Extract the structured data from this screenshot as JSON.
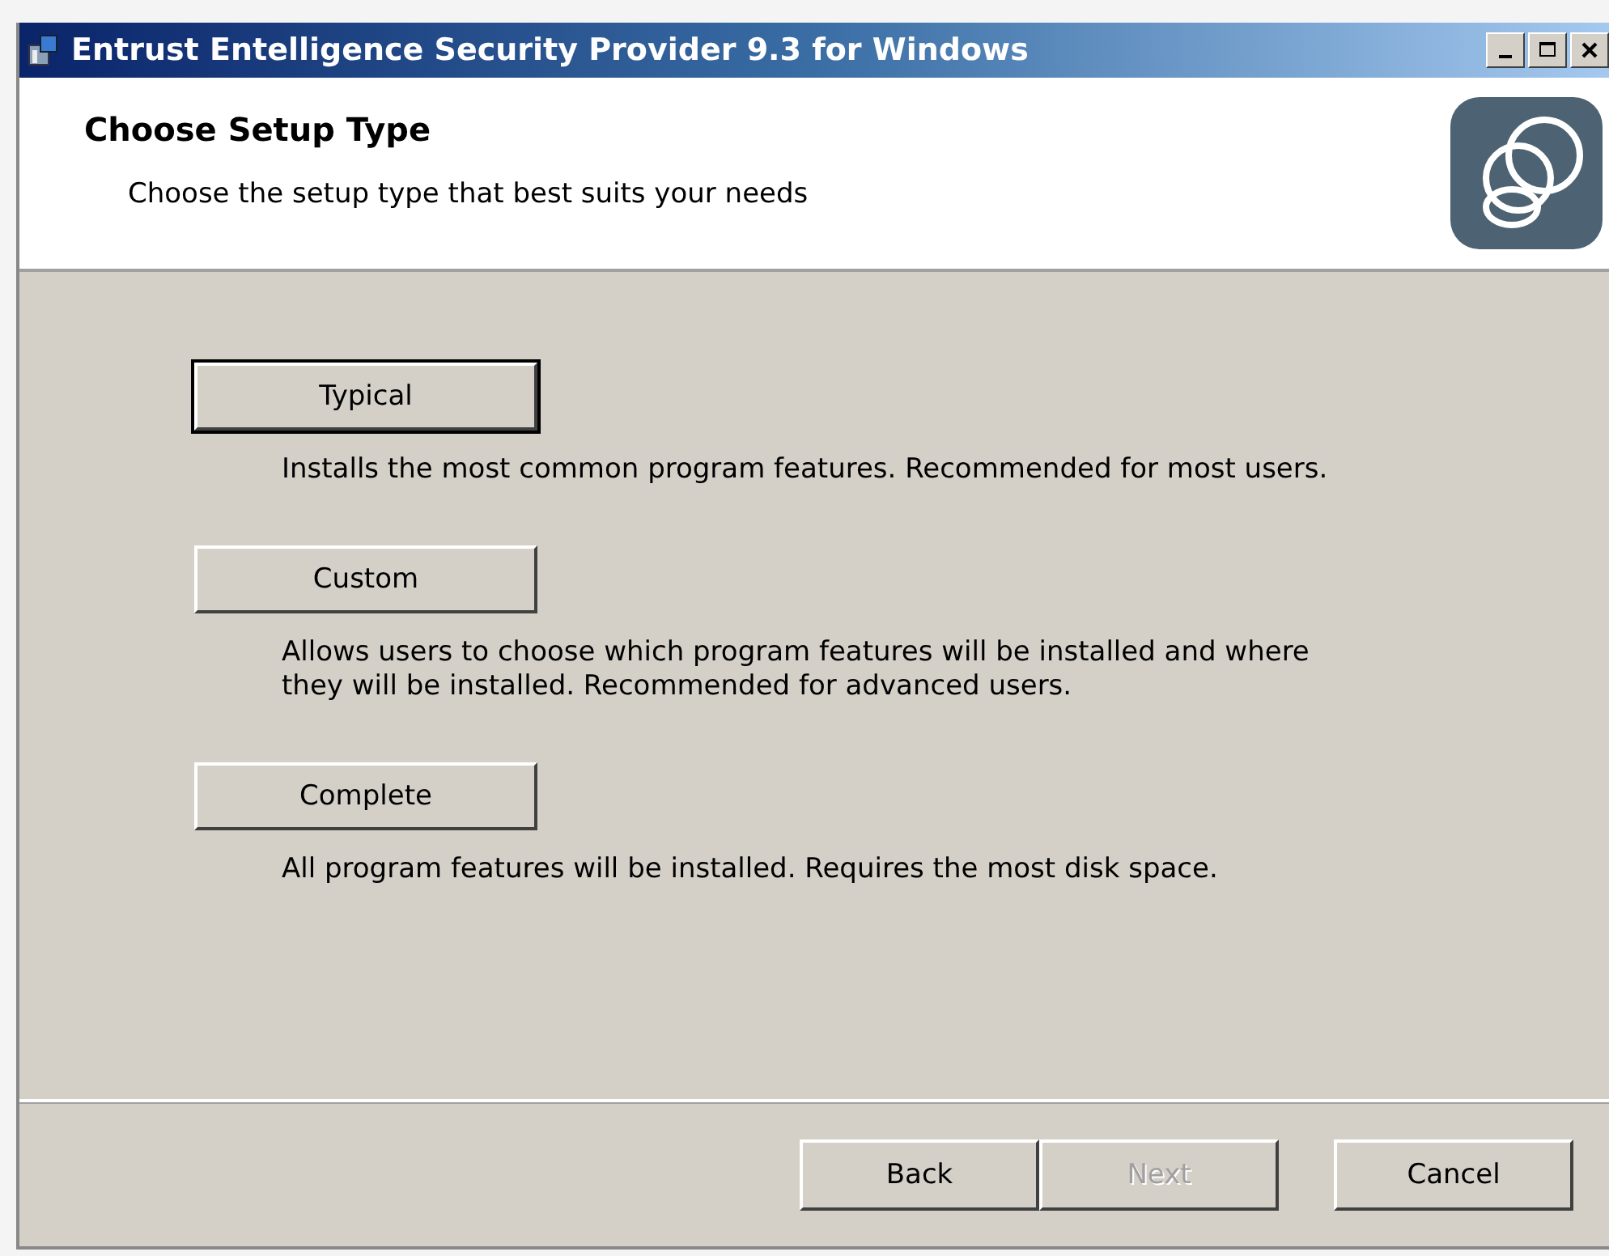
{
  "window": {
    "title": "Entrust Entelligence Security Provider 9.3 for Windows"
  },
  "header": {
    "title": "Choose Setup Type",
    "subtitle": "Choose the setup type that best suits your needs"
  },
  "setup_options": [
    {
      "label": "Typical",
      "focused": true,
      "description_lines": [
        "Installs the most common program features. Recommended for most users."
      ]
    },
    {
      "label": "Custom",
      "focused": false,
      "description_lines": [
        "Allows users to choose which program features will be installed and where",
        "they will be installed. Recommended for advanced users."
      ]
    },
    {
      "label": "Complete",
      "focused": false,
      "description_lines": [
        "All program features will be installed. Requires the most disk space."
      ]
    }
  ],
  "buttons": [
    {
      "label": "Back",
      "disabled": false
    },
    {
      "label": "Next",
      "disabled": true
    },
    {
      "label": "Cancel",
      "disabled": false
    }
  ]
}
